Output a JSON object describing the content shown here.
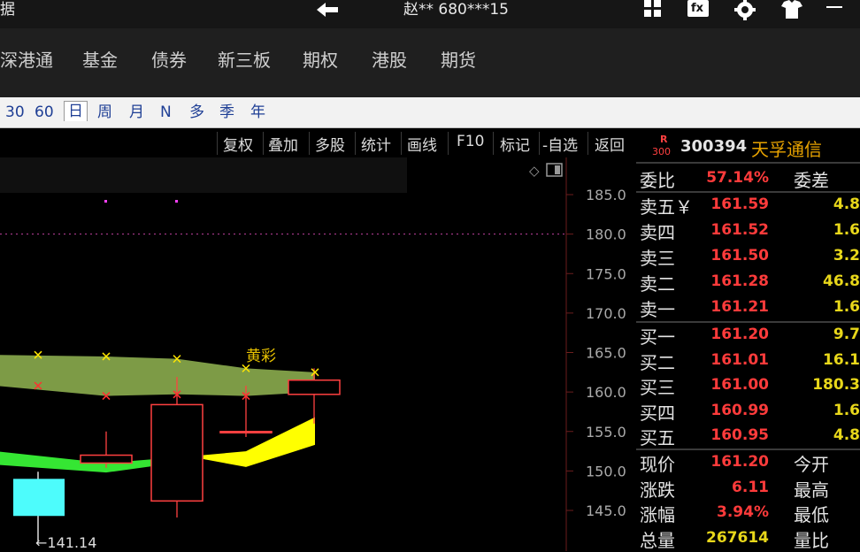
{
  "titlebar": {
    "left_text": "据",
    "account": "赵** 680***15",
    "icons": [
      "back-arrow-icon",
      "grid-menu-icon",
      "fx-icon",
      "gear-icon",
      "shirt-icon",
      "minimize-icon"
    ],
    "fx_label": "fx"
  },
  "market_nav": [
    "深港通",
    "基金",
    "债券",
    "新三板",
    "期权",
    "港股",
    "期货"
  ],
  "periods": [
    {
      "label": "30",
      "active": false
    },
    {
      "label": "60",
      "active": false
    },
    {
      "label": "日",
      "active": true
    },
    {
      "label": "周",
      "active": false
    },
    {
      "label": "月",
      "active": false
    },
    {
      "label": "N",
      "active": false
    },
    {
      "label": "多",
      "active": false
    },
    {
      "label": "季",
      "active": false
    },
    {
      "label": "年",
      "active": false
    }
  ],
  "toolbar": [
    "复权",
    "叠加",
    "多股",
    "统计",
    "画线",
    "F10",
    "标记",
    "-自选",
    "返回"
  ],
  "chart": {
    "y_ticks": [
      "185.0",
      "180.0",
      "175.0",
      "170.0",
      "165.0",
      "160.0",
      "155.0",
      "150.0",
      "145.0"
    ],
    "annotation": "黄彩",
    "low_label": "←141.14",
    "colors": {
      "up": "#ff4040",
      "down": "#4dfcfc",
      "band_olive": "#7d9b46",
      "band_green": "#35e633",
      "band_yellow": "#ffff00",
      "axis_text": "#aaaaaa"
    }
  },
  "chart_data": {
    "type": "candlestick",
    "ylim": [
      141,
      189
    ],
    "y_ticks": [
      185,
      180,
      175,
      170,
      165,
      160,
      155,
      150,
      145
    ],
    "ref_line": 180,
    "low_marker": 141.14,
    "candles": [
      {
        "open": 149.0,
        "close": 144.3,
        "high": 149.9,
        "low": 141.14,
        "color": "cyan"
      },
      {
        "open": 151.0,
        "close": 152.0,
        "high": 155.0,
        "low": 150.4,
        "color": "red"
      },
      {
        "open": 146.2,
        "close": 158.4,
        "high": 161.9,
        "low": 144.1,
        "color": "red"
      },
      {
        "open": 155.0,
        "close": 155.0,
        "high": 160.8,
        "low": 154.3,
        "color": "red"
      },
      {
        "open": 159.7,
        "close": 161.5,
        "high": 163.0,
        "low": 156.0,
        "color": "red"
      }
    ],
    "band_upper_top": [
      164.7,
      164.5,
      164.2,
      163.0,
      162.5
    ],
    "band_upper_bottom": [
      160.8,
      159.5,
      159.7,
      159.5,
      160.0
    ],
    "band_lower_top": [
      152.5,
      151.0,
      152.0,
      152.5,
      156.8
    ],
    "band_lower_bottom": [
      150.8,
      149.8,
      151.5,
      150.5,
      153.3
    ]
  },
  "stock": {
    "badge_top": "R",
    "badge_bottom": "300",
    "code": "300394",
    "name": "天孚通信"
  },
  "order_book": {
    "commission_label": "委比",
    "commission_value": "57.14%",
    "commission_diff_label": "委差",
    "sells": [
      {
        "label": "卖五￥",
        "price": "161.59",
        "vol": "4.8"
      },
      {
        "label": "卖四",
        "price": "161.52",
        "vol": "1.6"
      },
      {
        "label": "卖三",
        "price": "161.50",
        "vol": "3.2"
      },
      {
        "label": "卖二",
        "price": "161.28",
        "vol": "46.8"
      },
      {
        "label": "卖一",
        "price": "161.21",
        "vol": "1.6"
      }
    ],
    "buys": [
      {
        "label": "买一",
        "price": "161.20",
        "vol": "9.7"
      },
      {
        "label": "买二",
        "price": "161.01",
        "vol": "16.1"
      },
      {
        "label": "买三",
        "price": "161.00",
        "vol": "180.3"
      },
      {
        "label": "买四",
        "price": "160.99",
        "vol": "1.6"
      },
      {
        "label": "买五",
        "price": "160.95",
        "vol": "4.8"
      }
    ],
    "stats": [
      {
        "label": "现价",
        "value": "161.20",
        "label2": "今开"
      },
      {
        "label": "涨跌",
        "value": "6.11",
        "label2": "最高"
      },
      {
        "label": "涨幅",
        "value": "3.94%",
        "label2": "最低"
      },
      {
        "label": "总量",
        "value": "267614",
        "label2": "量比"
      }
    ]
  }
}
